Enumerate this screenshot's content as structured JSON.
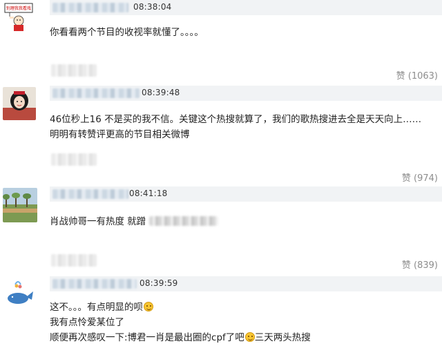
{
  "comments": [
    {
      "time": "08:38:04",
      "lines": [
        "你看看两个节目的收视率就懂了。。。。"
      ],
      "like_label": "赞",
      "like_count": "(1063)",
      "avatar": {
        "type": "cartoon-sign",
        "sign_text": "别理我我看戏"
      }
    },
    {
      "time": "08:39:48",
      "lines": [
        "46位秒上16 不是买的我不信。关键这个热搜就算了，我们的歌热搜进去全是天天向上……",
        "明明有转赞评更高的节目相关微博"
      ],
      "like_label": "赞",
      "like_count": "(974)",
      "avatar": {
        "type": "girl-photo"
      }
    },
    {
      "time": "08:41:18",
      "lines": [
        "肖战帅哥一有热度 就蹭"
      ],
      "like_label": "赞",
      "like_count": "(839)",
      "avatar": {
        "type": "landscape-photo"
      }
    },
    {
      "time": "08:39:59",
      "lines": [
        "这不。。。有点明显的呗",
        "我有点怜爱某位了",
        "顺便再次感叹一下:博君一肖是最出圈的cpf了吧",
        "三天两头热搜"
      ],
      "avatar": {
        "type": "whale-cartoon"
      }
    }
  ]
}
